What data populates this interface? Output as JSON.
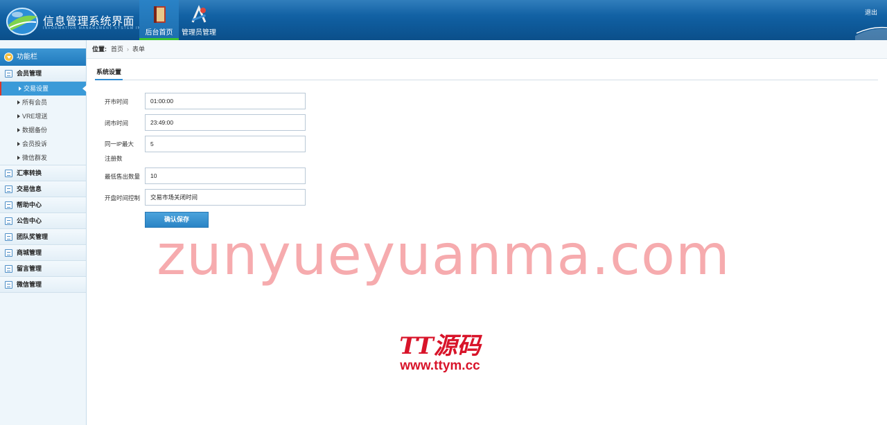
{
  "header": {
    "app_title": "信息管理系统界面",
    "app_subtitle": "INFORMATION MANAGEMENT SYSTEM INT",
    "nav": [
      {
        "label": "后台首页",
        "icon": "book-icon"
      },
      {
        "label": "管理员管理",
        "icon": "tools-icon"
      }
    ],
    "logout": "退出"
  },
  "sidebar": {
    "title": "功能栏",
    "groups": [
      {
        "label": "会员管理",
        "items": [
          "交易设置",
          "所有会员",
          "VRE增送",
          "数据备份",
          "会员投诉",
          "微信群发"
        ]
      },
      {
        "label": "汇率转换"
      },
      {
        "label": "交易信息"
      },
      {
        "label": "帮助中心"
      },
      {
        "label": "公告中心"
      },
      {
        "label": "团队奖管理"
      },
      {
        "label": "商城管理"
      },
      {
        "label": "留言管理"
      },
      {
        "label": "微信管理"
      }
    ],
    "active_item": "交易设置"
  },
  "breadcrumb": {
    "prefix": "位置:",
    "home": "首页",
    "current": "表单",
    "separator": "›"
  },
  "main": {
    "tab": "系统设置",
    "fields": [
      {
        "label": "开市时间",
        "value": "01:00:00"
      },
      {
        "label": "闭市时间",
        "value": "23:49:00"
      },
      {
        "label": "同一IP最大注册数",
        "value": "5"
      },
      {
        "label": "最低售出数量",
        "value": "10"
      },
      {
        "label": "开盘时间控制",
        "value": "交易市场关闭时间"
      }
    ],
    "submit": "确认保存"
  },
  "watermark": {
    "text": "zunyueyuanma.com",
    "logo_text": "TT源码",
    "logo_url": "www.ttym.cc"
  },
  "colors": {
    "header": "#0f5c9d",
    "accent": "#3a9ad8",
    "active_marker": "#d9352a",
    "nav_active_underline": "#3bc232"
  }
}
